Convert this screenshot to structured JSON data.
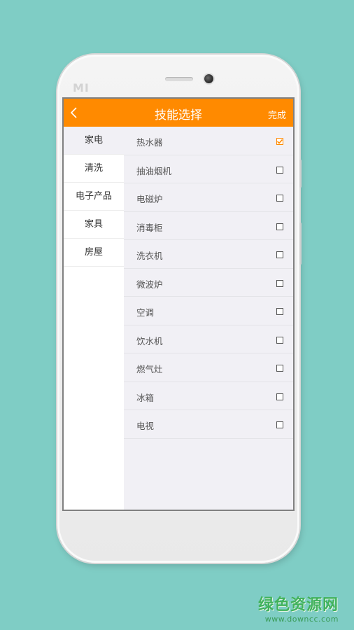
{
  "device": {
    "brand_text": "MI"
  },
  "header": {
    "title": "技能选择",
    "done_label": "完成",
    "accent_color": "#ff8a00"
  },
  "sidebar": {
    "items": [
      {
        "label": "家电",
        "active": true
      },
      {
        "label": "清洗",
        "active": false
      },
      {
        "label": "电子产品",
        "active": false
      },
      {
        "label": "家具",
        "active": false
      },
      {
        "label": "房屋",
        "active": false
      }
    ]
  },
  "list": {
    "items": [
      {
        "label": "热水器",
        "checked": true
      },
      {
        "label": "抽油烟机",
        "checked": false
      },
      {
        "label": "电磁炉",
        "checked": false
      },
      {
        "label": "消毒柜",
        "checked": false
      },
      {
        "label": "洗衣机",
        "checked": false
      },
      {
        "label": "微波炉",
        "checked": false
      },
      {
        "label": "空调",
        "checked": false
      },
      {
        "label": "饮水机",
        "checked": false
      },
      {
        "label": "燃气灶",
        "checked": false
      },
      {
        "label": "冰箱",
        "checked": false
      },
      {
        "label": "电视",
        "checked": false
      }
    ]
  },
  "watermark": {
    "main": "绿色资源网",
    "sub": "www.downcc.com"
  }
}
